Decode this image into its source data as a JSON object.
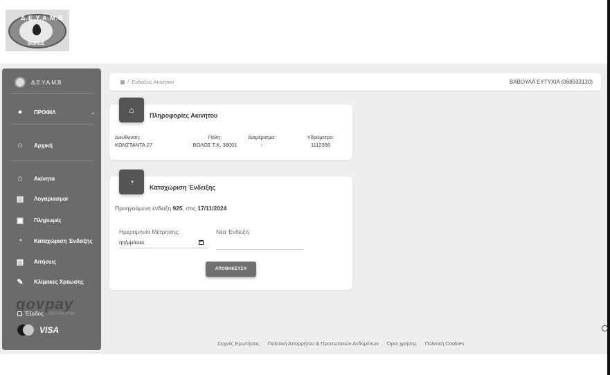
{
  "logo": {
    "top_text": "Δ.Ε.Υ.Α.Μ.Β",
    "bottom_text": "ΒΟΛΟΣ"
  },
  "sidebar": {
    "brand": "Δ.Ε.Υ.Α.Μ.Β",
    "profile": "ΠΡΟΦΙΛ",
    "items": [
      {
        "label": "Αρχική",
        "icon": "home-icon"
      },
      {
        "label": "Ακίνητα",
        "icon": "home-icon"
      },
      {
        "label": "Λογαριασμοί",
        "icon": "document-icon"
      },
      {
        "label": "Πληρωμές",
        "icon": "wallet-icon"
      },
      {
        "label": "Καταχώριση Ένδειξης",
        "icon": "gauge-icon"
      },
      {
        "label": "Αιτήσεις",
        "icon": "document-icon"
      },
      {
        "label": "Κλίμακες Χρέωσης",
        "icon": "edit-icon"
      }
    ],
    "govpay": "govpay",
    "exit": "Έξοδος",
    "exit_sub": "ΠΛΑΤΦΟΡΜΑ",
    "visa": "VISA"
  },
  "topbar": {
    "breadcrumb": "Ενδείξεις Ακινήτου",
    "user": "ΒΑΒΟΥΛΑ ΕΥΤΥΧΙΑ (068933130)"
  },
  "property": {
    "title": "Πληροφορίες Ακινήτου",
    "address_label": "Διεύθυνση:",
    "address": "ΚΩΝΣΤΑΝΤΑ 27",
    "city_label": "Πόλη:",
    "city": "ΒΟΛΟΣ Τ.Κ. 38001",
    "apartment_label": "Διαμέρισμα:",
    "apartment": "-",
    "meter_label": "Υδρόμετρο:",
    "meter": "1112356"
  },
  "reading": {
    "title": "Καταχώριση Ένδειξης",
    "prev_text": "Προηγούμενη ένδειξη",
    "prev_value": "925",
    "prev_sep": ", στις",
    "prev_date": "17/11/2024",
    "date_label": "Ημερομηνία Μέτρησης:",
    "date_placeholder": "ηη/μμ/εεεε",
    "new_label": "Νέα Ένδειξη:",
    "save": "ΑΠΟΘΗΚΕΥΣΗ"
  },
  "footer": {
    "faq": "Συχνές Ερωτήσεις",
    "privacy": "Πολιτική Απορρήτου & Προσωπικών Δεδομένων",
    "terms": "Όροι χρήσης",
    "cookies": "Πολιτική Cookies"
  }
}
